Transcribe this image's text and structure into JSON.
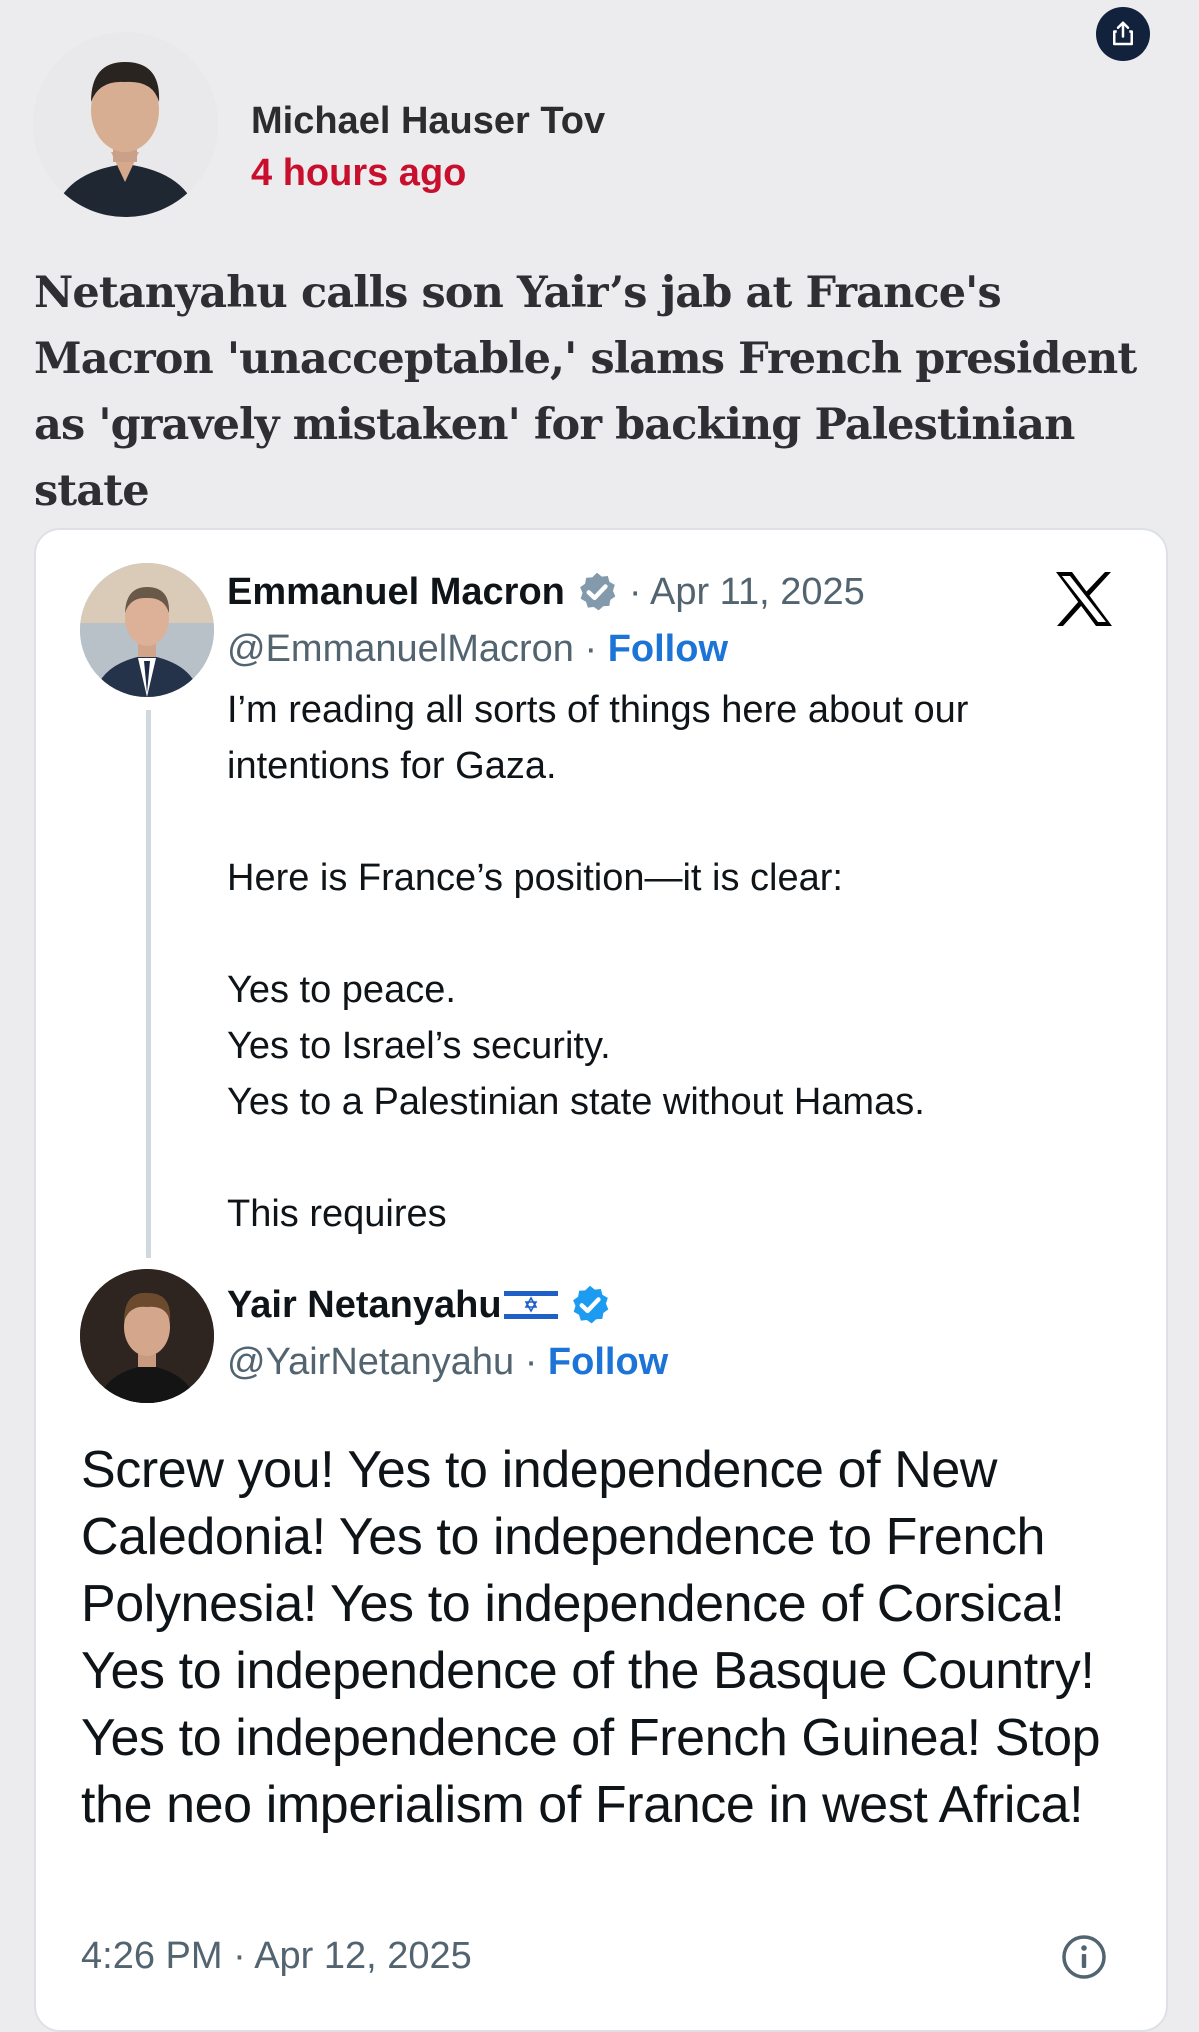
{
  "article": {
    "author_name": "Michael Hauser Tov",
    "time_ago": "4 hours ago",
    "headline": "Netanyahu calls son Yair’s jab at France's Macron 'unacceptable,' slams French president as 'gravely mistaken' for backing Palestinian state"
  },
  "icons": {
    "share": "share-icon",
    "verified": "verified-badge-icon",
    "x_logo": "x-logo-icon",
    "info": "info-icon",
    "flag": "israel-flag-icon"
  },
  "colors": {
    "accent_red": "#c8102e",
    "follow_blue": "#1d74d7",
    "verified_blue": "#1d9bf0",
    "share_bg": "#12213c"
  },
  "embed": {
    "parent_tweet": {
      "name": "Emmanuel Macron",
      "date": "· Apr 11, 2025",
      "handle": "@EmmanuelMacron",
      "separator": " · ",
      "follow": "Follow",
      "lines": [
        "I’m reading all sorts of things here about our intentions for Gaza.",
        "Here is France’s position—it is clear:",
        "Yes to peace.",
        "Yes to Israel’s security.",
        "Yes to a Palestinian state without Hamas.",
        "This requires"
      ]
    },
    "reply_tweet": {
      "name": "Yair Netanyahu",
      "handle": "@YairNetanyahu",
      "separator": " · ",
      "follow": "Follow",
      "text": "Screw you! Yes to independence of New Caledonia! Yes to independence to French Polynesia! Yes to independence of Corsica! Yes to independence of the Basque Country! Yes to independence of French Guinea! Stop the neo imperialism of France in west Africa!",
      "timestamp": "4:26 PM · Apr 12, 2025"
    }
  }
}
